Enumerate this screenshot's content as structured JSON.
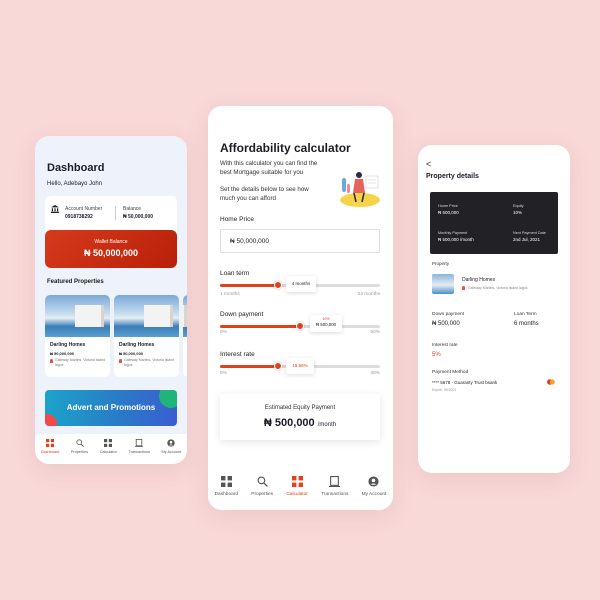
{
  "left": {
    "title": "Dashboard",
    "greeting": "Hello, Adebayo John",
    "account_number_label": "Account Number",
    "account_number": "0918738292",
    "balance_label": "Balance",
    "balance": "₦ 50,000,000",
    "wallet_label": "Wallet Balance",
    "wallet_value": "₦ 50,000,000",
    "featured_label": "Featured Properties",
    "properties": [
      {
        "name": "Darling Homes",
        "price": "₦ 50,000,000",
        "location": "Gateway Martins, Victoria Island lagos"
      },
      {
        "name": "Darling Homes",
        "price": "₦ 50,000,000",
        "location": "Gateway Martins, Victoria Island lagos"
      }
    ],
    "advert": "Advert and Promotions",
    "nav": [
      "Dashboard",
      "Properties",
      "Calculator",
      "Transactions",
      "My Account"
    ]
  },
  "mid": {
    "title": "Affordability calculator",
    "subtitle": "With this calculator you can find the best Mortgage suitable for you",
    "instruction": "Set the details below to see how much you can afford",
    "home_price_label": "Home Price",
    "home_price": "₦ 50,000,000",
    "loan_term_label": "Loan term",
    "loan_term_value": "4 months",
    "loan_term_fraction": 0.36,
    "loan_min": "1 months",
    "loan_max": "24 months",
    "down_payment_label": "Down payment",
    "down_payment_pct": "10%",
    "down_payment_value": "₦ 500,000",
    "down_payment_fraction": 0.5,
    "down_min": "0%",
    "down_max": "50%",
    "interest_label": "Interest rate",
    "interest_value": "15.55%",
    "interest_fraction": 0.36,
    "interest_min": "0%",
    "interest_max": "40%",
    "equity_label": "Estimated Equity Payment",
    "equity_value": "₦ 500,000",
    "equity_unit": "/month",
    "nav": [
      "Dashboard",
      "Properties",
      "Calculator",
      "Transactions",
      "My Account"
    ],
    "active_nav": "Calculator"
  },
  "right": {
    "back": "<",
    "title": "Property details",
    "home_price_label": "Home Price",
    "home_price": "₦ 500,000",
    "equity_label": "Equity",
    "equity": "10%",
    "monthly_label": "Monthly Payment",
    "monthly": "₦ 500,000 /month",
    "next_date_label": "Next Payment Date",
    "next_date": "2nd Jul, 2021",
    "property_section": "Property",
    "property_name": "Darling Homes",
    "property_location": "Gateway Martins, Victoria Island lagos",
    "down_payment_label": "Down payment",
    "down_payment": "₦ 500,000",
    "loan_term_label": "Loan Term",
    "loan_term": "6 months",
    "interest_label": "Interest rate",
    "interest": "5%",
    "payment_method_label": "Payment Method",
    "card": "**** 5678 - Guaranty Trust bsank",
    "expiry": "Expire: 09/2021"
  },
  "colors": {
    "accent": "#e0411f",
    "dark_card": "#212126",
    "background": "#f9d8d8"
  }
}
